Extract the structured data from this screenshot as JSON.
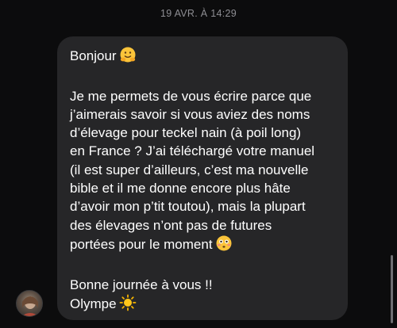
{
  "conversation": {
    "timestamp": "19 AVR. À 14:29"
  },
  "message": {
    "greeting": "Bonjour",
    "body_lines": [
      "Je me permets de vous écrire parce que",
      "j’aimerais savoir si vous aviez des noms",
      "d’élevage pour teckel nain (à poil long)",
      "en France ? J’ai téléchargé votre manuel",
      "(il est super d’ailleurs, c’est ma nouvelle",
      "bible et il me donne encore plus hâte",
      "d’avoir mon p’tit toutou), mais la plupart",
      "des élevages n’ont pas de futures",
      "portées pour le moment"
    ],
    "closing_line": "Bonne journée à vous !!",
    "signature": "Olympe",
    "emojis": {
      "greeting": "hugging-face-emoji",
      "body_end": "flushed-face-emoji",
      "signature": "sun-emoji"
    }
  },
  "colors": {
    "background": "#0c0c0d",
    "bubble": "#262628",
    "text": "#ffffff",
    "timestamp": "#8e8e93"
  }
}
